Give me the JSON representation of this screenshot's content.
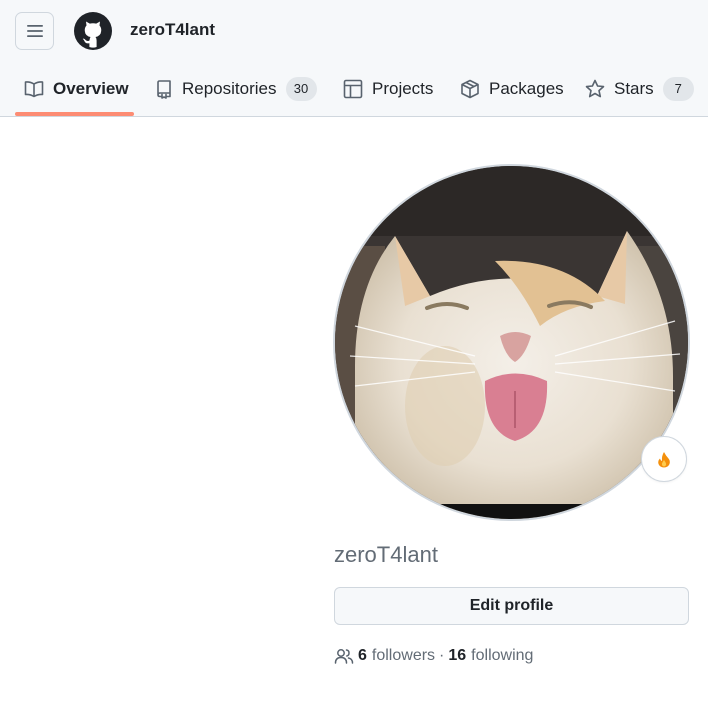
{
  "header": {
    "username": "zeroT4lant"
  },
  "tabs": [
    {
      "label": "Overview",
      "icon": "book-icon"
    },
    {
      "label": "Repositories",
      "icon": "repo-icon",
      "count": "30"
    },
    {
      "label": "Projects",
      "icon": "table-icon"
    },
    {
      "label": "Packages",
      "icon": "package-icon"
    },
    {
      "label": "Stars",
      "icon": "star-icon",
      "count": "7"
    }
  ],
  "profile": {
    "login": "zeroT4lant",
    "edit_label": "Edit profile",
    "status_emoji": "fire-icon",
    "followers_count": "6",
    "followers_label": "followers",
    "separator": "·",
    "following_count": "16",
    "following_label": "following"
  },
  "colors": {
    "active_tab_underline": "#fd8c73",
    "muted_text": "#636c76"
  }
}
